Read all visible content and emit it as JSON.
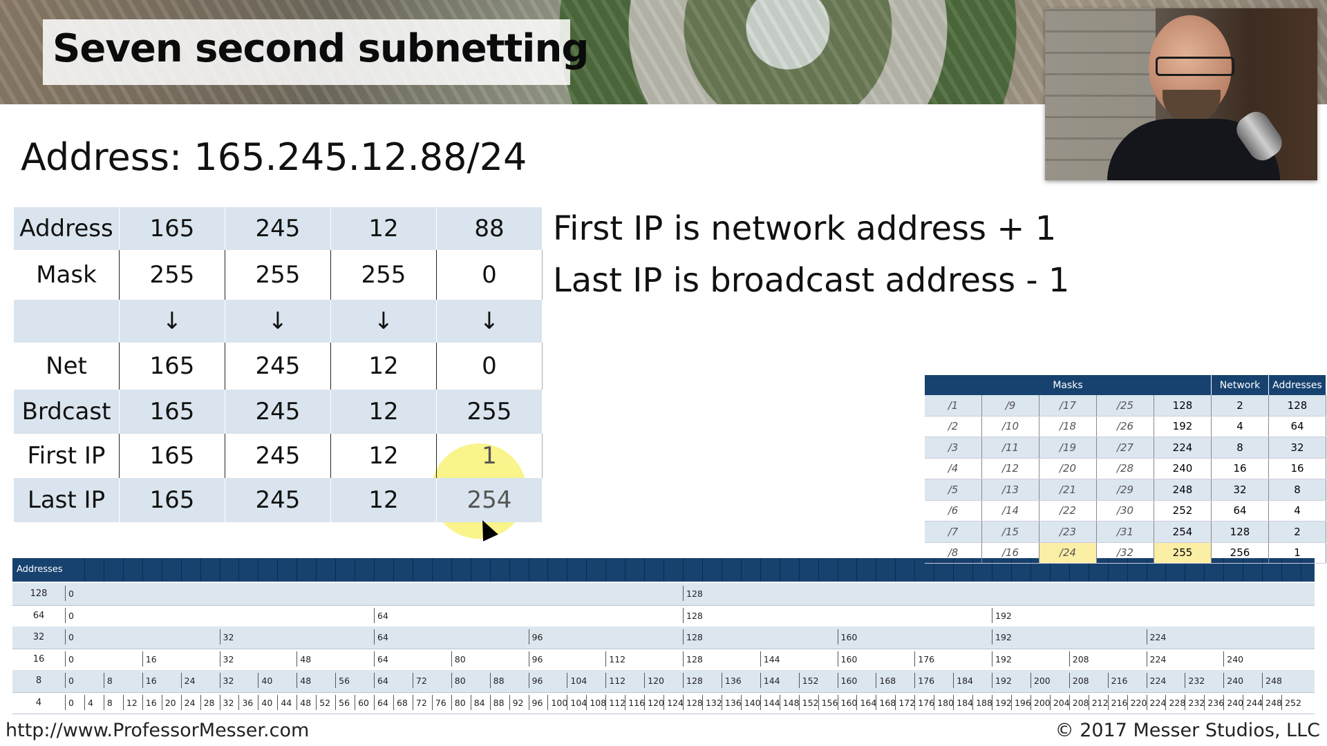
{
  "slide": {
    "title": "Seven second subnetting",
    "address_heading": "Address: 165.245.12.88/24",
    "notes": [
      "First IP is network address + 1",
      "Last IP is broadcast address - 1"
    ],
    "footer_left": "http://www.ProfessorMesser.com",
    "footer_right": "© 2017 Messer Studios, LLC"
  },
  "subnet_table": {
    "rows": [
      {
        "label": "Address",
        "values": [
          "165",
          "245",
          "12",
          "88"
        ]
      },
      {
        "label": "Mask",
        "values": [
          "255",
          "255",
          "255",
          "0"
        ]
      },
      {
        "label": "",
        "values": [
          "↓",
          "↓",
          "↓",
          "↓"
        ]
      },
      {
        "label": "Net",
        "values": [
          "165",
          "245",
          "12",
          "0"
        ]
      },
      {
        "label": "Brdcast",
        "values": [
          "165",
          "245",
          "12",
          "255"
        ]
      },
      {
        "label": "First IP",
        "values": [
          "165",
          "245",
          "12",
          "1"
        ]
      },
      {
        "label": "Last IP",
        "values": [
          "165",
          "245",
          "12",
          "254"
        ]
      }
    ],
    "highlight_color": "#f7f064"
  },
  "mask_table": {
    "headers": {
      "masks": "Masks",
      "network": "Network",
      "addresses": "Addresses"
    },
    "rows": [
      [
        "/1",
        "/9",
        "/17",
        "/25",
        "128",
        "2",
        "128"
      ],
      [
        "/2",
        "/10",
        "/18",
        "/26",
        "192",
        "4",
        "64"
      ],
      [
        "/3",
        "/11",
        "/19",
        "/27",
        "224",
        "8",
        "32"
      ],
      [
        "/4",
        "/12",
        "/20",
        "/28",
        "240",
        "16",
        "16"
      ],
      [
        "/5",
        "/13",
        "/21",
        "/29",
        "248",
        "32",
        "8"
      ],
      [
        "/6",
        "/14",
        "/22",
        "/30",
        "252",
        "64",
        "4"
      ],
      [
        "/7",
        "/15",
        "/23",
        "/31",
        "254",
        "128",
        "2"
      ],
      [
        "/8",
        "/16",
        "/24",
        "/32",
        "255",
        "256",
        "1"
      ]
    ],
    "header_color": "#17426f"
  },
  "address_blocks": {
    "header_label": "Addresses",
    "rows": [
      {
        "size": "128",
        "starts": [
          "0",
          "128"
        ]
      },
      {
        "size": "64",
        "starts": [
          "0",
          "64",
          "128",
          "192"
        ]
      },
      {
        "size": "32",
        "starts": [
          "0",
          "32",
          "64",
          "96",
          "128",
          "160",
          "192",
          "224"
        ]
      },
      {
        "size": "16",
        "starts": [
          "0",
          "16",
          "32",
          "48",
          "64",
          "80",
          "96",
          "112",
          "128",
          "144",
          "160",
          "176",
          "192",
          "208",
          "224",
          "240"
        ]
      },
      {
        "size": "8",
        "starts": [
          "0",
          "8",
          "16",
          "24",
          "32",
          "40",
          "48",
          "56",
          "64",
          "72",
          "80",
          "88",
          "96",
          "104",
          "112",
          "120",
          "128",
          "136",
          "144",
          "152",
          "160",
          "168",
          "176",
          "184",
          "192",
          "200",
          "208",
          "216",
          "224",
          "232",
          "240",
          "248"
        ]
      },
      {
        "size": "4",
        "starts": [
          "0",
          "4",
          "8",
          "12",
          "16",
          "20",
          "24",
          "28",
          "32",
          "36",
          "40",
          "44",
          "48",
          "52",
          "56",
          "60",
          "64",
          "68",
          "72",
          "76",
          "80",
          "84",
          "88",
          "92",
          "96",
          "100",
          "104",
          "108",
          "112",
          "116",
          "120",
          "124",
          "128",
          "132",
          "136",
          "140",
          "144",
          "148",
          "152",
          "156",
          "160",
          "164",
          "168",
          "172",
          "176",
          "180",
          "184",
          "188",
          "192",
          "196",
          "200",
          "204",
          "208",
          "212",
          "216",
          "220",
          "224",
          "228",
          "232",
          "236",
          "240",
          "244",
          "248",
          "252"
        ]
      }
    ]
  }
}
